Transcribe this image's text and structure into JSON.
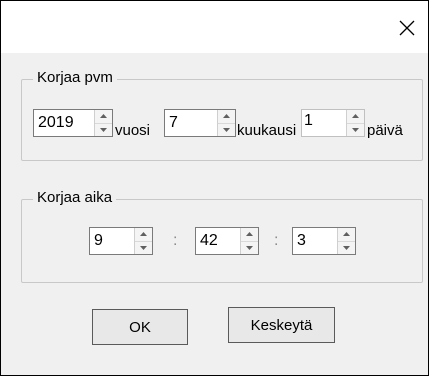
{
  "date_group": {
    "label": "Korjaa pvm",
    "fields": [
      {
        "value": "2019",
        "unit": "vuosi"
      },
      {
        "value": "7",
        "unit": "kuukausi"
      },
      {
        "value": "1",
        "unit": "päivä"
      }
    ]
  },
  "time_group": {
    "label": "Korjaa aika",
    "fields": [
      {
        "value": "9"
      },
      {
        "value": "42"
      },
      {
        "value": "3"
      }
    ],
    "separator": ":"
  },
  "buttons": {
    "ok_label": "OK",
    "cancel_label": "Keskeytä"
  },
  "icons": {
    "close": "close-icon",
    "spin_up": "chevron-up-icon",
    "spin_down": "chevron-down-icon"
  }
}
